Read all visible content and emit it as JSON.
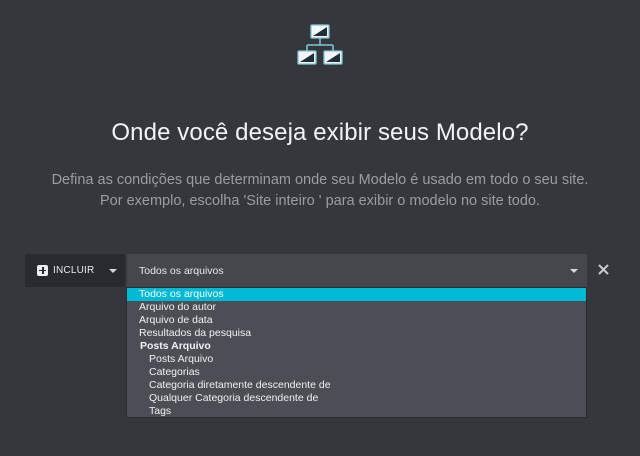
{
  "header": {
    "icon": "sitemap-icon",
    "title": "Onde você deseja exibir seus Modelo?",
    "description_line1": "Defina as condições que determinam onde seu Modelo é usado em todo o seu site.",
    "description_line2": "Por exemplo, escolha 'Site inteiro ' para exibir o modelo no site todo."
  },
  "condition": {
    "include_label": "INCLUIR",
    "include_icon": "plus-square-icon",
    "selected_value": "Todos os arquivos",
    "remove_icon": "close-icon"
  },
  "dropdown": {
    "options": [
      {
        "label": "Todos os arquivos",
        "type": "option",
        "selected": true
      },
      {
        "label": "Arquivo do autor",
        "type": "option"
      },
      {
        "label": "Arquivo de data",
        "type": "option"
      },
      {
        "label": "Resultados da pesquisa",
        "type": "option"
      },
      {
        "label": "Posts Arquivo",
        "type": "group"
      },
      {
        "label": "Posts Arquivo",
        "type": "child"
      },
      {
        "label": "Categorias",
        "type": "child"
      },
      {
        "label": "Categoria diretamente descendente de",
        "type": "child"
      },
      {
        "label": "Qualquer Categoria descendente de",
        "type": "child"
      },
      {
        "label": "Tags",
        "type": "child"
      }
    ]
  },
  "colors": {
    "background": "#34373c",
    "accent": "#00b9d4",
    "dropdown_bg": "#4b4e54",
    "select_bg": "#44474c"
  }
}
